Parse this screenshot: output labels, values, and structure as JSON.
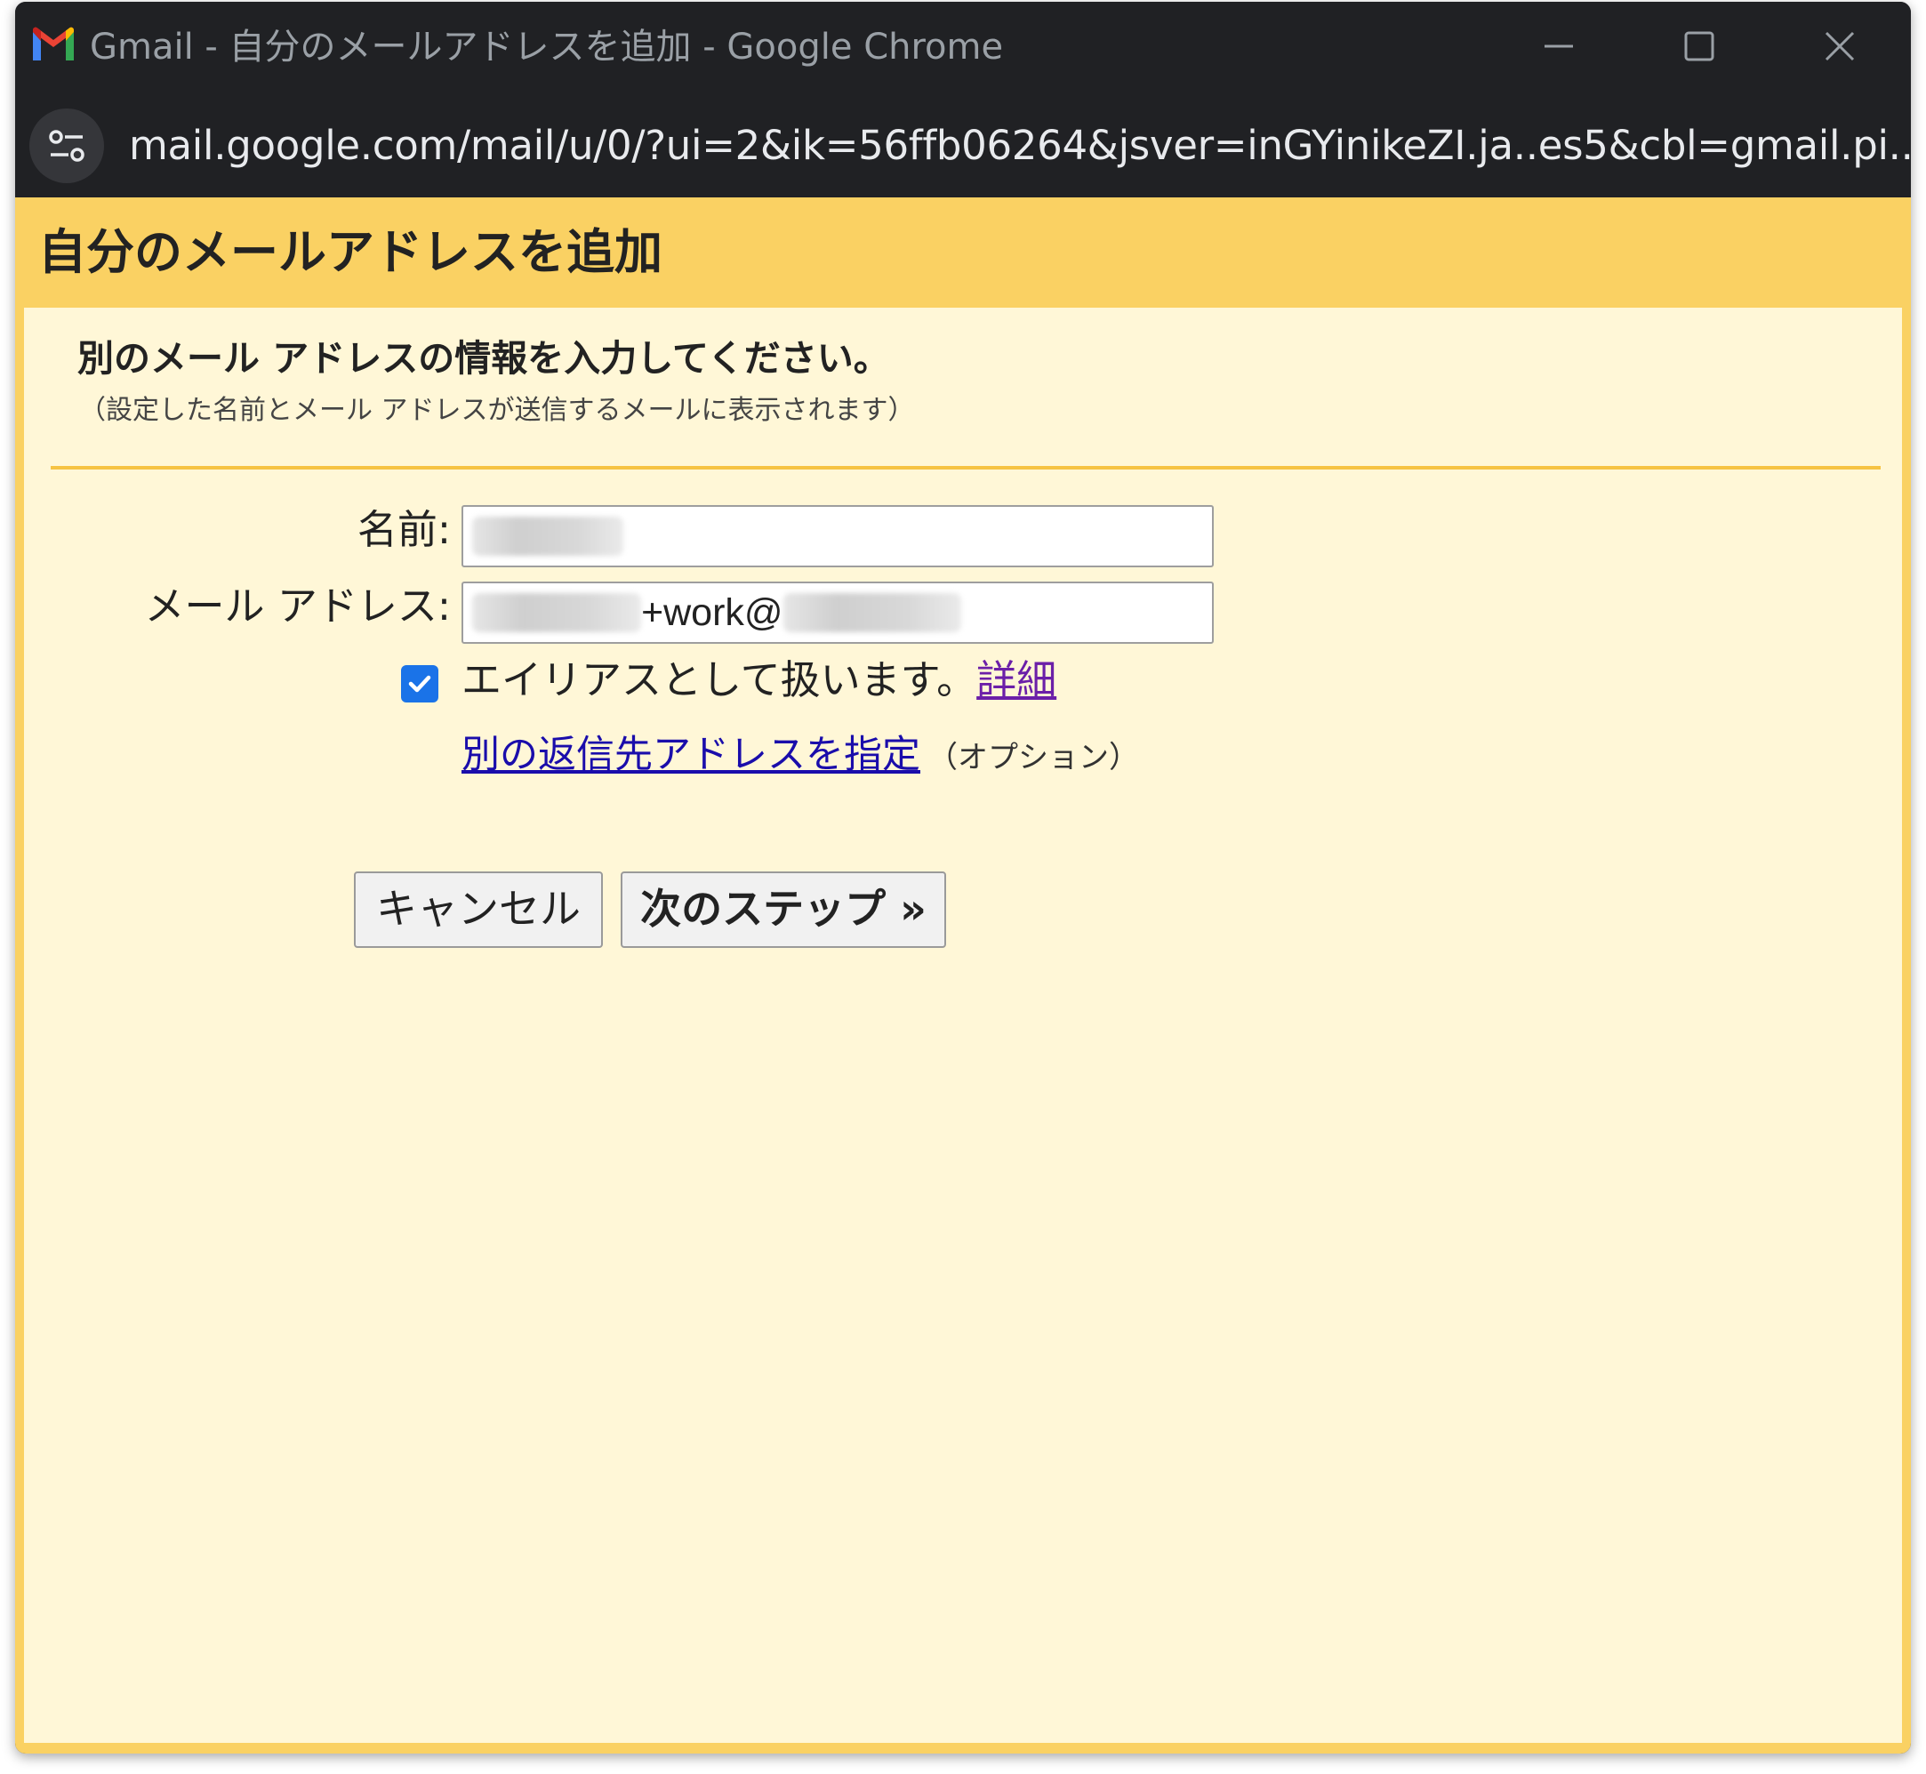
{
  "window": {
    "title": "Gmail - 自分のメールアドレスを追加 - Google Chrome",
    "url": "mail.google.com/mail/u/0/?ui=2&ik=56ffb06264&jsver=inGYinikeZI.ja..es5&cbl=gmail.pi..."
  },
  "dialog": {
    "heading": "自分のメールアドレスを追加",
    "prompt": "別のメール アドレスの情報を入力してください。",
    "prompt_note": "（設定した名前とメール アドレスが送信するメールに表示されます）",
    "name_label": "名前:",
    "email_label": "メール アドレス:",
    "email_visible_part": "+work@",
    "alias_text": "エイリアスとして扱います。",
    "alias_checked": true,
    "details_link": "詳細",
    "reply_to_link": "別の返信先アドレスを指定",
    "reply_to_optional": "（オプション）",
    "cancel_button": "キャンセル",
    "next_button": "次のステップ »"
  },
  "colors": {
    "header_bg": "#fad163",
    "content_bg": "#fff7d7",
    "divider": "#f6c343",
    "chrome_bg": "#202124",
    "checkbox": "#1a73e8"
  }
}
